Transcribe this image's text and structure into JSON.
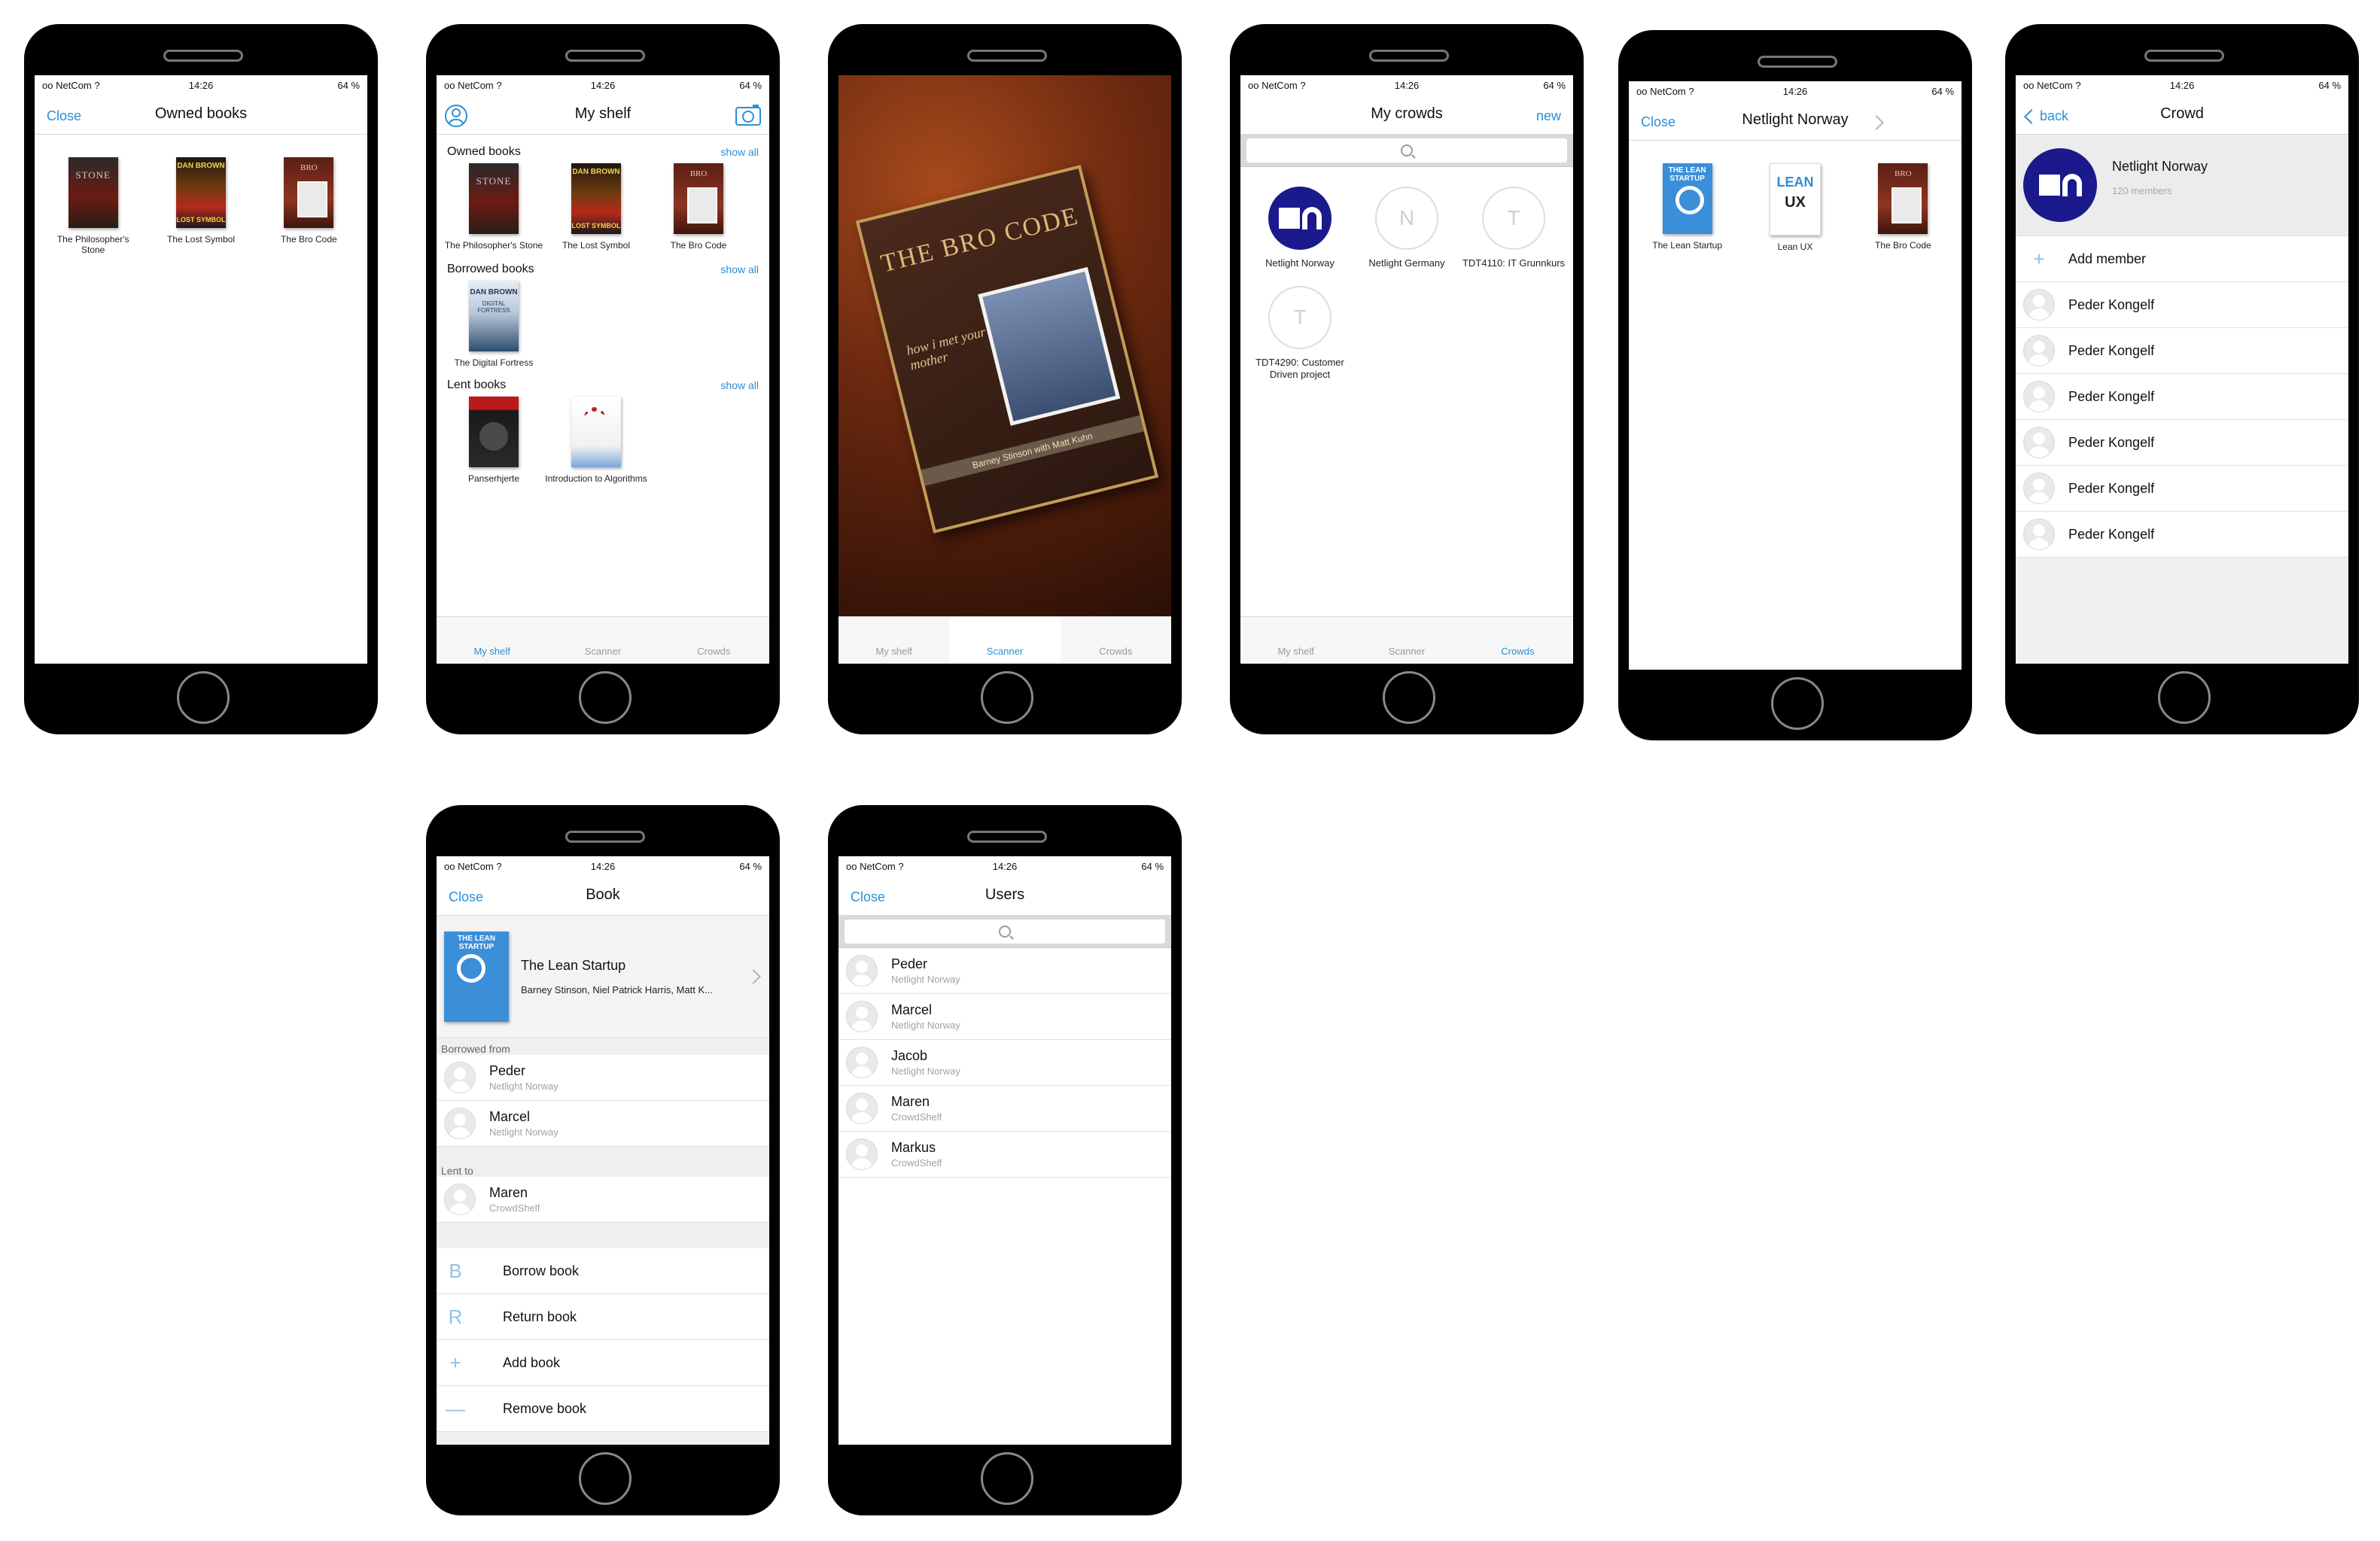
{
  "status": {
    "carrier": "oo NetCom ?",
    "time": "14:26",
    "battery": "64 %"
  },
  "owned": {
    "nav_left": "Close",
    "title": "Owned books",
    "books": [
      {
        "title": "The Philosopher's Stone"
      },
      {
        "title": "The Lost Symbol"
      },
      {
        "title": "The Bro Code"
      }
    ]
  },
  "shelf": {
    "title": "My shelf",
    "left_icon": "person-circle-icon",
    "right_icon": "camera-icon",
    "sections": [
      {
        "title": "Owned books",
        "show_all": "show all",
        "books": [
          {
            "title": "The Philosopher's Stone"
          },
          {
            "title": "The Lost Symbol"
          },
          {
            "title": "The Bro Code"
          }
        ]
      },
      {
        "title": "Borrowed books",
        "show_all": "show all",
        "books": [
          {
            "title": "The Digital Fortress"
          }
        ]
      },
      {
        "title": "Lent books",
        "show_all": "show all",
        "books": [
          {
            "title": "Panserhjerte"
          },
          {
            "title": "Introduction to Algorithms"
          }
        ]
      }
    ]
  },
  "tabs": [
    "My shelf",
    "Scanner",
    "Crowds"
  ],
  "scanner": {
    "cover_title": "THE BRO CODE",
    "cover_tagline": "how i met your mother",
    "cover_authors": "Barney Stinson with Matt Kuhn"
  },
  "crowds": {
    "title": "My crowds",
    "nav_right": "new",
    "items": [
      {
        "label": "Netlight Norway",
        "initial": ""
      },
      {
        "label": "Netlight Germany",
        "initial": "N"
      },
      {
        "label": "TDT4110: IT Grunnkurs",
        "initial": "T"
      },
      {
        "label": "TDT4290: Customer Driven project",
        "initial": "T"
      }
    ]
  },
  "netlight": {
    "nav_left": "Close",
    "title": "Netlight Norway",
    "books": [
      {
        "title": "The Lean Startup"
      },
      {
        "title": "Lean UX"
      },
      {
        "title": "The Bro Code"
      }
    ]
  },
  "crowd": {
    "nav_left": "back",
    "title": "Crowd",
    "name": "Netlight Norway",
    "members": "120 members",
    "add_member": "Add member",
    "people": [
      "Peder Kongelf",
      "Peder Kongelf",
      "Peder Kongelf",
      "Peder Kongelf",
      "Peder Kongelf",
      "Peder Kongelf"
    ]
  },
  "book": {
    "nav_left": "Close",
    "title": "Book",
    "book_title": "The Lean Startup",
    "authors": "Barney Stinson, Niel Patrick Harris, Matt K...",
    "borrowed_from": "Borrowed from",
    "borrowed": [
      {
        "name": "Peder",
        "sub": "Netlight Norway"
      },
      {
        "name": "Marcel",
        "sub": "Netlight Norway"
      }
    ],
    "lent_to": "Lent to",
    "lent": [
      {
        "name": "Maren",
        "sub": "CrowdShelf"
      }
    ],
    "actions": [
      {
        "icon": "B",
        "label": "Borrow book"
      },
      {
        "icon": "R",
        "label": "Return book"
      },
      {
        "icon": "+",
        "label": "Add book"
      },
      {
        "icon": "—",
        "label": "Remove book"
      }
    ]
  },
  "users": {
    "nav_left": "Close",
    "title": "Users",
    "list": [
      {
        "name": "Peder",
        "sub": "Netlight Norway"
      },
      {
        "name": "Marcel",
        "sub": "Netlight Norway"
      },
      {
        "name": "Jacob",
        "sub": "Netlight Norway"
      },
      {
        "name": "Maren",
        "sub": "CrowdShelf"
      },
      {
        "name": "Markus",
        "sub": "CrowdShelf"
      }
    ]
  }
}
